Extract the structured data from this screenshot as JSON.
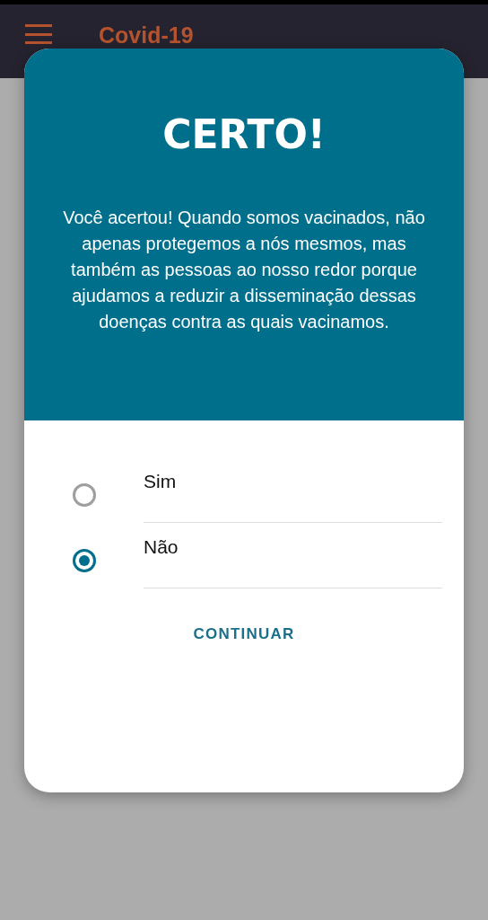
{
  "app_bar": {
    "title": "Covid-19"
  },
  "dialog": {
    "title": "CERTO!",
    "message": "Você acertou! Quando somos vacinados, não apenas protegemos a nós mesmos, mas também as pessoas ao nosso redor porque ajudamos a reduzir a disseminação dessas doenças contra as quais vacinamos.",
    "options": [
      {
        "label": "Sim",
        "selected": false
      },
      {
        "label": "Não",
        "selected": true
      }
    ],
    "button": "CONTINUAR"
  }
}
